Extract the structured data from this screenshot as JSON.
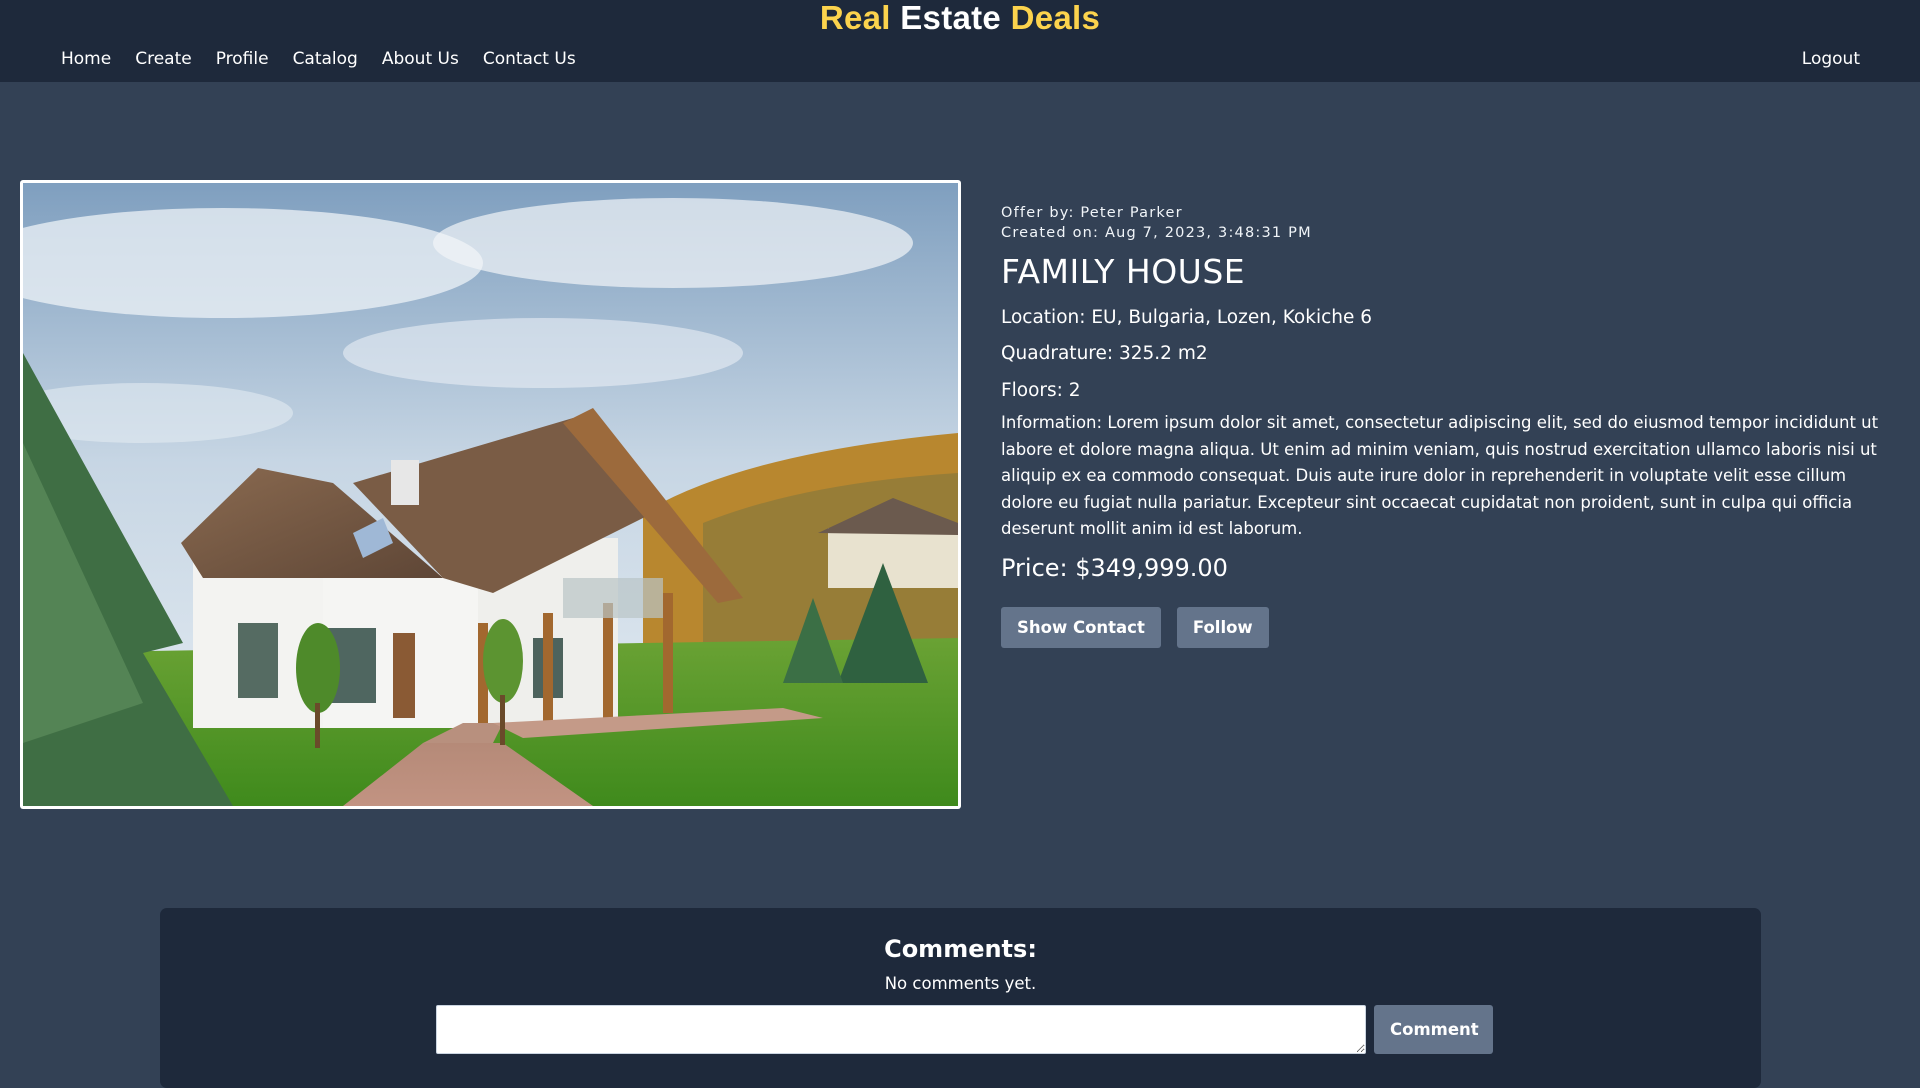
{
  "header": {
    "brand": {
      "word1": "Real",
      "word2": "Estate",
      "word3": "Deals"
    },
    "nav": [
      "Home",
      "Create",
      "Profile",
      "Catalog",
      "About Us",
      "Contact Us"
    ],
    "logout": "Logout"
  },
  "offer": {
    "photo_alt": "Family house with garden",
    "offer_by": "Offer by: Peter Parker",
    "created_on": "Created on: Aug 7, 2023, 3:48:31 PM",
    "title": "FAMILY HOUSE",
    "location": "Location: EU, Bulgaria, Lozen, Kokiche 6",
    "quadrature": "Quadrature: 325.2 m2",
    "floors": "Floors: 2",
    "information": "Information: Lorem ipsum dolor sit amet, consectetur adipiscing elit, sed do eiusmod tempor incididunt ut labore et dolore magna aliqua. Ut enim ad minim veniam, quis nostrud exercitation ullamco laboris nisi ut aliquip ex ea commodo consequat. Duis aute irure dolor in reprehenderit in voluptate velit esse cillum dolore eu fugiat nulla pariatur. Excepteur sint occaecat cupidatat non proident, sunt in culpa qui officia deserunt mollit anim id est laborum.",
    "price": "Price: $349,999.00",
    "buttons": {
      "show_contact": "Show Contact",
      "follow": "Follow"
    }
  },
  "comments": {
    "title": "Comments:",
    "empty_text": "No comments yet.",
    "input_value": "",
    "button": "Comment"
  },
  "colors": {
    "page_bg": "#334155",
    "header_bg": "#1e293b",
    "brand_accent": "#fcd34d",
    "button_bg": "#64748b"
  }
}
